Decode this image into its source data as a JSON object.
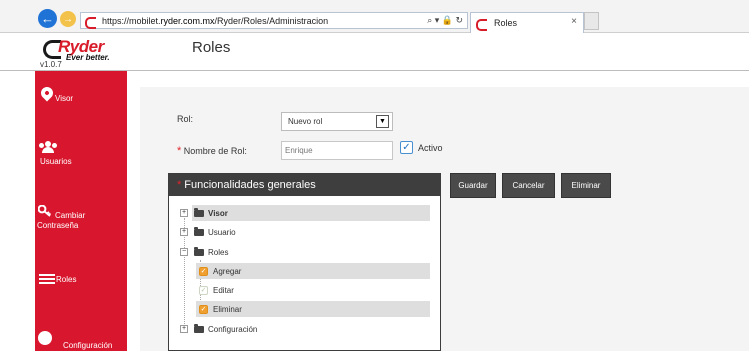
{
  "browser": {
    "url_prefix": "https://mobilet.",
    "url_domain": "ryder.com.mx",
    "url_path": "/Ryder/Roles/Administracion",
    "address_icons": "⌕ ▾ 🔒 ↻",
    "tab_title": "Roles",
    "tab_close": "×"
  },
  "header": {
    "brand_name": "Ryder",
    "brand_tagline": "Ever better.",
    "version": "v1.0.7",
    "page_title": "Roles"
  },
  "sidebar": {
    "items": [
      {
        "label": "Visor",
        "icon": "map-pin-icon"
      },
      {
        "label": "Usuarios",
        "icon": "users-icon"
      },
      {
        "label": "Cambiar",
        "label2": "Contraseña",
        "icon": "key-icon"
      },
      {
        "label": "Roles",
        "icon": "list-icon"
      },
      {
        "label": "Configuración",
        "icon": "gear-icon"
      }
    ]
  },
  "form": {
    "rol_label": "Rol:",
    "rol_selected": "Nuevo rol",
    "required_mark": "*",
    "nombre_label": "Nombre de Rol:",
    "nombre_value": "Enrique",
    "activo_label": "Activo",
    "activo_checked": true
  },
  "buttons": {
    "guardar": "Guardar",
    "cancelar": "Cancelar",
    "eliminar": "Eliminar"
  },
  "panel": {
    "title": "Funcionalidades generales",
    "tree": [
      {
        "label": "Visor",
        "type": "folder",
        "expander": "+",
        "highlighted": true
      },
      {
        "label": "Usuario",
        "type": "folder",
        "expander": "+"
      },
      {
        "label": "Roles",
        "type": "folder-open",
        "expander": "−"
      },
      {
        "label": "Agregar",
        "type": "check",
        "checked": true,
        "highlighted": true
      },
      {
        "label": "Editar",
        "type": "check",
        "checked": false
      },
      {
        "label": "Eliminar",
        "type": "check",
        "checked": true,
        "highlighted": true
      },
      {
        "label": "Configuración",
        "type": "folder",
        "expander": "+"
      }
    ]
  },
  "colors": {
    "sidebar": "#d8172e",
    "brand_red": "#d91c2a",
    "button_dark": "#4a4a4a",
    "panel_header": "#3e3e3e",
    "check_orange": "#f0a030"
  }
}
